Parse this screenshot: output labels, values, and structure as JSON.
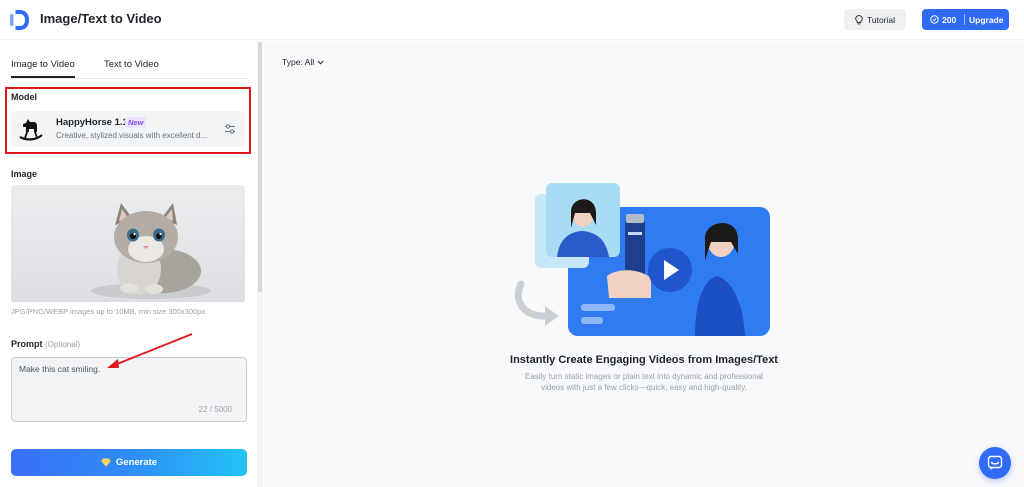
{
  "header": {
    "title": "Image/Text to Video",
    "tutorial_label": "Tutorial",
    "credits": "200",
    "upgrade_label": "Upgrade",
    "accent_color": "#2f6bf6"
  },
  "tabs": [
    {
      "label": "Image to Video",
      "active": true
    },
    {
      "label": "Text to Video",
      "active": false
    }
  ],
  "model": {
    "section_label": "Model",
    "name": "HappyHorse 1.1",
    "badge": "New",
    "description": "Creative, stylized visuals with excellent d...",
    "icon": "rocking-horse-icon"
  },
  "image": {
    "section_label": "Image",
    "hint": "JPG/PNG/WEBP images up to 10MB, min size 300x300px."
  },
  "prompt": {
    "label": "Prompt",
    "optional": "(Optional)",
    "value": "Make this cat smiling.",
    "count": "22 / 5000"
  },
  "generate_label": "Generate",
  "filter": {
    "label": "Type: All"
  },
  "empty_state": {
    "title": "Instantly Create Engaging Videos from Images/Text",
    "desc_line1": "Easily turn static images or plain text into dynamic and professional",
    "desc_line2": "videos with just a few clicks—quick, easy and high-quality."
  },
  "annotation_color": "#e0191f"
}
